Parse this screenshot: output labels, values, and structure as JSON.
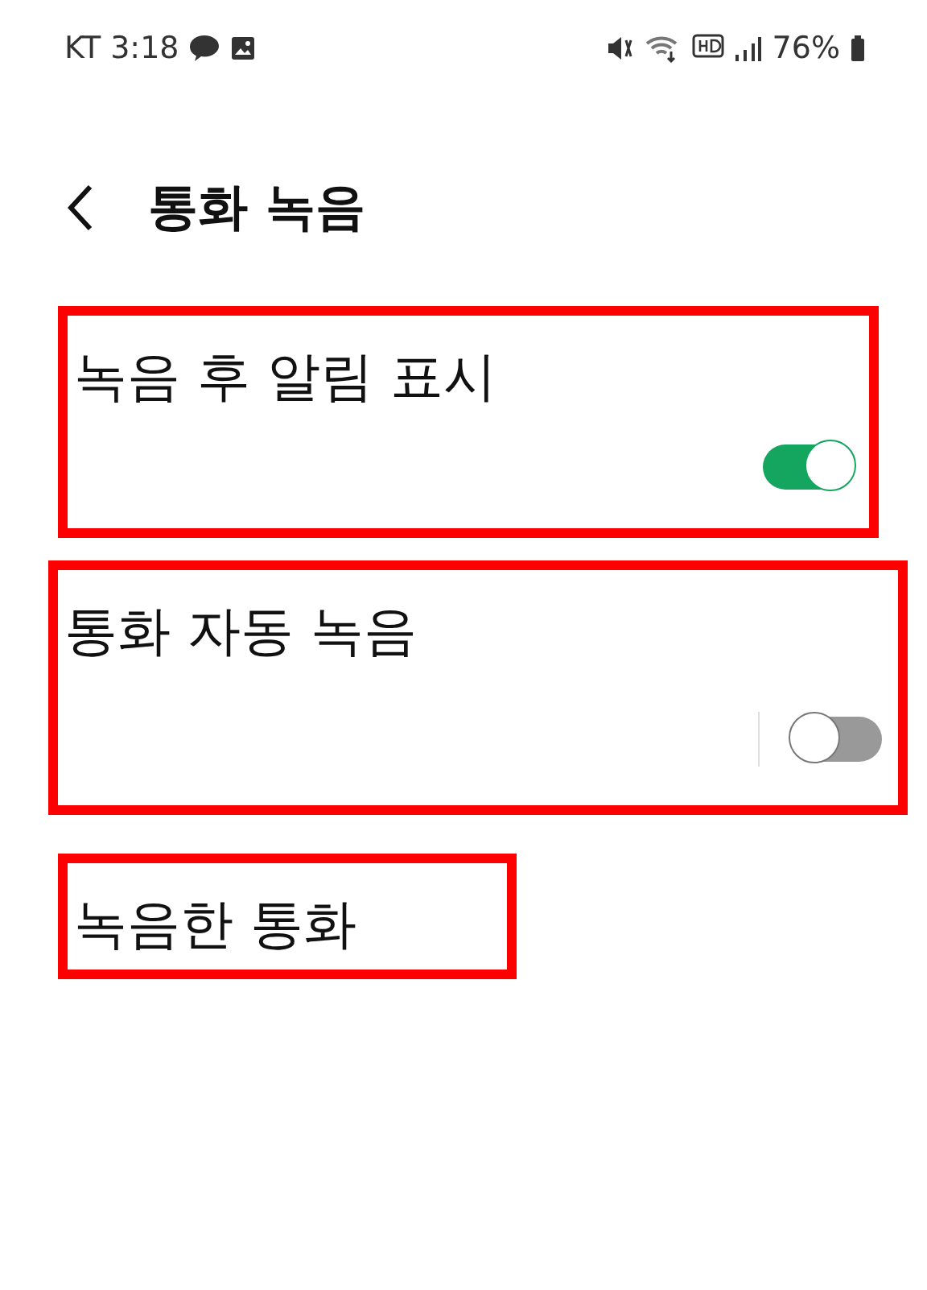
{
  "status_bar": {
    "carrier": "KT",
    "time": "3:18",
    "battery": "76%"
  },
  "header": {
    "title": "통화 녹음"
  },
  "items": [
    {
      "kind": "toggle",
      "label": "녹음 후 알림 표시",
      "on": true,
      "highlighted": true
    },
    {
      "kind": "toggle",
      "label": "통화 자동 녹음",
      "on": false,
      "highlighted": true
    },
    {
      "kind": "link",
      "label": "녹음한 통화",
      "highlighted": true
    }
  ]
}
